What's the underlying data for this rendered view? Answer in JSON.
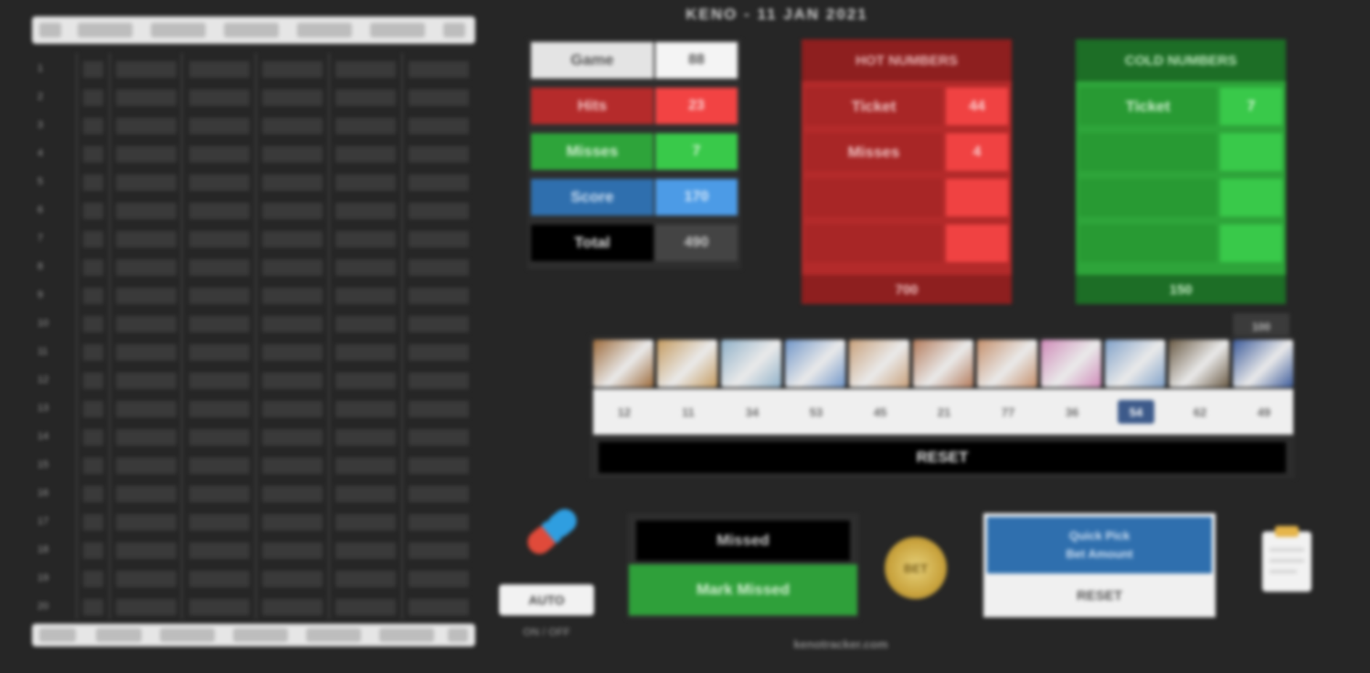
{
  "title": "KENO - 11 JAN 2021",
  "colors": {
    "background": "#262626",
    "red_dark": "#b52b2b",
    "red_light": "#f24343",
    "green_dark": "#2ea43a",
    "green_light": "#39c94a",
    "blue_dark": "#2f6fae",
    "blue_light": "#4c9be6",
    "panel_dark_red": "#8e1f1f",
    "panel_dark_green": "#1d6e26"
  },
  "stats": {
    "rows": [
      {
        "label": "Game",
        "value": "88",
        "style": "header"
      },
      {
        "label": "Hits",
        "value": "23",
        "style": "red"
      },
      {
        "label": "Misses",
        "value": "7",
        "style": "green"
      },
      {
        "label": "Score",
        "value": "170",
        "style": "blue"
      },
      {
        "label": "Total",
        "value": "490",
        "style": "dark"
      }
    ]
  },
  "red_panel": {
    "header": "HOT NUMBERS",
    "rows": [
      {
        "label": "Ticket",
        "value": "44"
      },
      {
        "label": "Misses",
        "value": "4"
      },
      {
        "label": "",
        "value": ""
      },
      {
        "label": "",
        "value": ""
      }
    ],
    "footer": "700"
  },
  "green_panel": {
    "header": "COLD NUMBERS",
    "rows": [
      {
        "label": "Ticket",
        "value": "7"
      },
      {
        "label": "",
        "value": ""
      },
      {
        "label": "",
        "value": ""
      },
      {
        "label": "",
        "value": ""
      }
    ],
    "footer": "150"
  },
  "draw_strip": {
    "corner_label": "100",
    "numbers": [
      "12",
      "11",
      "34",
      "53",
      "45",
      "21",
      "77",
      "36",
      "54",
      "62",
      "49"
    ],
    "highlight_index": 8,
    "bar_label": "RESET",
    "image_colors": [
      "#9c6a3a",
      "#c49a5e",
      "#8fb0c8",
      "#6f95c8",
      "#c8a07a",
      "#b37a5a",
      "#c48e6a",
      "#cf8ab8",
      "#7fa0c8",
      "#6a5a44",
      "#3b5a9a"
    ]
  },
  "table": {
    "headers": [
      "#",
      "Draw",
      "Hits",
      "Miss",
      "Score",
      "Total",
      "+"
    ],
    "footer": [
      "Tot",
      "",
      "",
      "",
      "",
      "",
      ""
    ],
    "row_numbers": [
      "1",
      "2",
      "3",
      "4",
      "5",
      "6",
      "7",
      "8",
      "9",
      "10",
      "11",
      "12",
      "13",
      "14",
      "15",
      "16",
      "17",
      "18",
      "19",
      "20"
    ]
  },
  "controls": {
    "toggle_label": "AUTO",
    "toggle_sub": "ON / OFF",
    "missed_label": "Missed",
    "missed_button": "Mark Missed",
    "coin_label": "BET",
    "blue_line1": "Quick Pick",
    "blue_line2": "Bet Amount",
    "blue_button": "RESET"
  },
  "footer": "kenotracker.com"
}
